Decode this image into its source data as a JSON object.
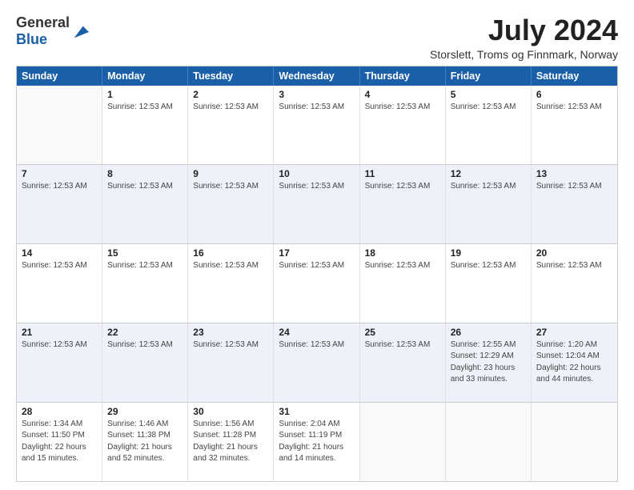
{
  "logo": {
    "general": "General",
    "blue": "Blue"
  },
  "header": {
    "month_year": "July 2024",
    "location": "Storslett, Troms og Finnmark, Norway"
  },
  "weekdays": [
    "Sunday",
    "Monday",
    "Tuesday",
    "Wednesday",
    "Thursday",
    "Friday",
    "Saturday"
  ],
  "weeks": [
    {
      "days": [
        {
          "number": "",
          "info": []
        },
        {
          "number": "1",
          "info": [
            "Sunrise: 12:53 AM"
          ]
        },
        {
          "number": "2",
          "info": [
            "Sunrise: 12:53 AM"
          ]
        },
        {
          "number": "3",
          "info": [
            "Sunrise: 12:53 AM"
          ]
        },
        {
          "number": "4",
          "info": [
            "Sunrise: 12:53 AM"
          ]
        },
        {
          "number": "5",
          "info": [
            "Sunrise: 12:53 AM"
          ]
        },
        {
          "number": "6",
          "info": [
            "Sunrise: 12:53 AM"
          ]
        }
      ]
    },
    {
      "days": [
        {
          "number": "7",
          "info": [
            "Sunrise: 12:53 AM"
          ]
        },
        {
          "number": "8",
          "info": [
            "Sunrise: 12:53 AM"
          ]
        },
        {
          "number": "9",
          "info": [
            "Sunrise: 12:53 AM"
          ]
        },
        {
          "number": "10",
          "info": [
            "Sunrise: 12:53 AM"
          ]
        },
        {
          "number": "11",
          "info": [
            "Sunrise: 12:53 AM"
          ]
        },
        {
          "number": "12",
          "info": [
            "Sunrise: 12:53 AM"
          ]
        },
        {
          "number": "13",
          "info": [
            "Sunrise: 12:53 AM"
          ]
        }
      ]
    },
    {
      "days": [
        {
          "number": "14",
          "info": [
            "Sunrise: 12:53 AM"
          ]
        },
        {
          "number": "15",
          "info": [
            "Sunrise: 12:53 AM"
          ]
        },
        {
          "number": "16",
          "info": [
            "Sunrise: 12:53 AM"
          ]
        },
        {
          "number": "17",
          "info": [
            "Sunrise: 12:53 AM"
          ]
        },
        {
          "number": "18",
          "info": [
            "Sunrise: 12:53 AM"
          ]
        },
        {
          "number": "19",
          "info": [
            "Sunrise: 12:53 AM"
          ]
        },
        {
          "number": "20",
          "info": [
            "Sunrise: 12:53 AM"
          ]
        }
      ]
    },
    {
      "days": [
        {
          "number": "21",
          "info": [
            "Sunrise: 12:53 AM"
          ]
        },
        {
          "number": "22",
          "info": [
            "Sunrise: 12:53 AM"
          ]
        },
        {
          "number": "23",
          "info": [
            "Sunrise: 12:53 AM"
          ]
        },
        {
          "number": "24",
          "info": [
            "Sunrise: 12:53 AM"
          ]
        },
        {
          "number": "25",
          "info": [
            "Sunrise: 12:53 AM"
          ]
        },
        {
          "number": "26",
          "info": [
            "Sunrise: 12:55 AM",
            "Sunset: 12:29 AM",
            "Daylight: 23 hours and 33 minutes."
          ]
        },
        {
          "number": "27",
          "info": [
            "Sunrise: 1:20 AM",
            "Sunset: 12:04 AM",
            "Daylight: 22 hours and 44 minutes."
          ]
        }
      ]
    },
    {
      "days": [
        {
          "number": "28",
          "info": [
            "Sunrise: 1:34 AM",
            "Sunset: 11:50 PM",
            "Daylight: 22 hours and 15 minutes."
          ]
        },
        {
          "number": "29",
          "info": [
            "Sunrise: 1:46 AM",
            "Sunset: 11:38 PM",
            "Daylight: 21 hours and 52 minutes."
          ]
        },
        {
          "number": "30",
          "info": [
            "Sunrise: 1:56 AM",
            "Sunset: 11:28 PM",
            "Daylight: 21 hours and 32 minutes."
          ]
        },
        {
          "number": "31",
          "info": [
            "Sunrise: 2:04 AM",
            "Sunset: 11:19 PM",
            "Daylight: 21 hours and 14 minutes."
          ]
        },
        {
          "number": "",
          "info": []
        },
        {
          "number": "",
          "info": []
        },
        {
          "number": "",
          "info": []
        }
      ]
    }
  ]
}
